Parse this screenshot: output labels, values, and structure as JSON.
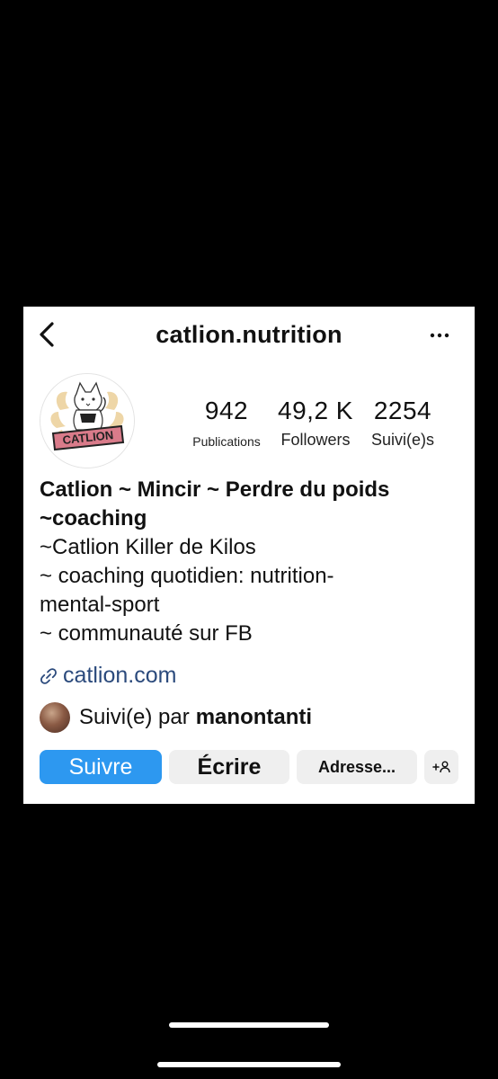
{
  "header": {
    "username": "catlion.nutrition",
    "back_icon": "chevron-left-icon",
    "more_icon": "more-horizontal-icon"
  },
  "avatar": {
    "brand_text": "CATLION"
  },
  "stats": {
    "publications": {
      "value": "942",
      "label": "Publications"
    },
    "followers": {
      "value": "49,2 K",
      "label": "Followers"
    },
    "following": {
      "value": "2254",
      "label": "Suivi(e)s"
    }
  },
  "bio": {
    "name": "Catlion ~ Mincir ~ Perdre du poids",
    "name_line2": "~coaching",
    "lines": [
      "~Catlion Killer de Kilos",
      "~ coaching quotidien: nutrition-",
      "mental-sport",
      "~ communauté sur FB"
    ]
  },
  "website": {
    "text": "catlion.com",
    "icon": "link-icon"
  },
  "followed_by": {
    "prefix": "Suivi(e) par",
    "user": "manontanti"
  },
  "actions": {
    "follow": "Suivre",
    "message": "Écrire",
    "address": "Adresse...",
    "suggest_icon": "add-person-icon"
  },
  "colors": {
    "follow_blue": "#2d98f0",
    "link_blue": "#2b4a7c",
    "button_gray": "#efefef",
    "background": "#000000"
  }
}
